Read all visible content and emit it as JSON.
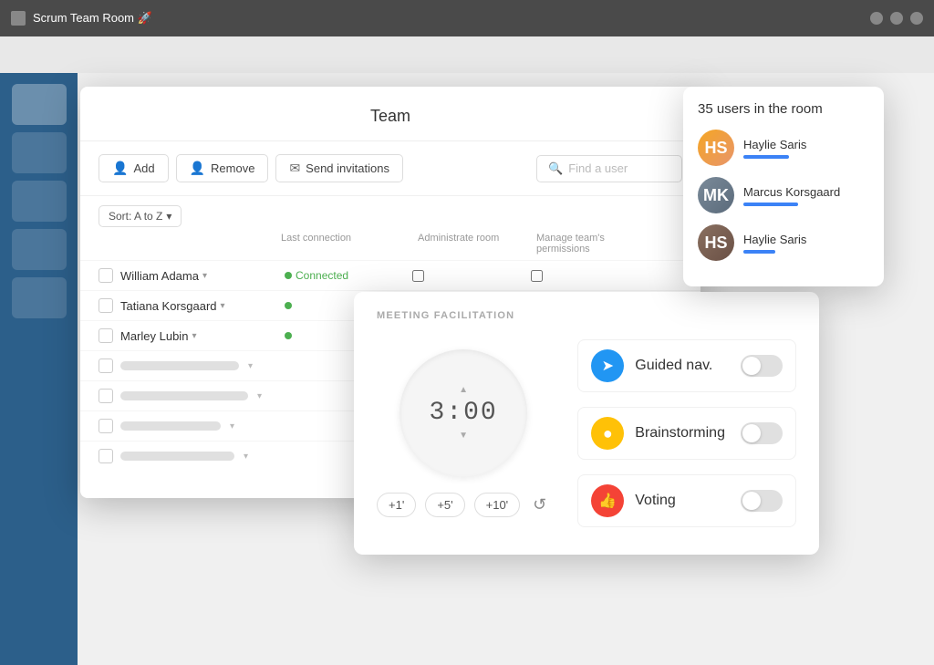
{
  "titlebar": {
    "title": "Scrum Team Room 🚀",
    "icon": "■"
  },
  "users_panel": {
    "count_label": "35 users in the room",
    "users": [
      {
        "name": "Haylie Saris",
        "initials": "HS",
        "avatar_class": "avatar-1",
        "bar_class": "user-bar-sm"
      },
      {
        "name": "Marcus Korsgaard",
        "initials": "MK",
        "avatar_class": "avatar-2",
        "bar_class": "user-bar-md"
      },
      {
        "name": "Haylie Saris",
        "initials": "HS",
        "avatar_class": "avatar-3",
        "bar_class": "user-bar-xs"
      }
    ]
  },
  "team_modal": {
    "title": "Team",
    "toolbar": {
      "add_label": "Add",
      "remove_label": "Remove",
      "invite_label": "Send invitations",
      "search_placeholder": "Find a user"
    },
    "sort": {
      "label": "Sort: A to Z"
    },
    "table": {
      "headers": {
        "last_connection": "Last connection",
        "admin_room": "Administrate room",
        "manage_permissions": "Manage team's permissions"
      },
      "rows": [
        {
          "name": "William Adama",
          "connection": "Connected",
          "connected": true,
          "show_connection": true
        },
        {
          "name": "Tatiana Korsgaard",
          "connection": "",
          "connected": true,
          "show_connection": false
        },
        {
          "name": "Marley Lubin",
          "connection": "",
          "connected": true,
          "show_connection": false
        },
        {
          "name": "",
          "connection": "",
          "connected": true,
          "show_connection": false
        },
        {
          "name": "",
          "connection": "",
          "connected": true,
          "show_connection": false
        },
        {
          "name": "",
          "connection": "",
          "connected": true,
          "show_connection": false
        },
        {
          "name": "",
          "connection": "",
          "connected": true,
          "show_connection": false
        }
      ]
    }
  },
  "meeting_panel": {
    "title": "MEETING FACILITATION",
    "timer": {
      "display": "3:00",
      "btn_plus1": "+1'",
      "btn_plus5": "+5'",
      "btn_plus10": "+10'"
    },
    "features": [
      {
        "name": "Guided nav.",
        "icon": "➤",
        "icon_class": "blue",
        "on": false
      },
      {
        "name": "Brainstorming",
        "icon": "●",
        "icon_class": "yellow",
        "on": false
      },
      {
        "name": "Voting",
        "icon": "👍",
        "icon_class": "red",
        "on": false
      }
    ]
  }
}
